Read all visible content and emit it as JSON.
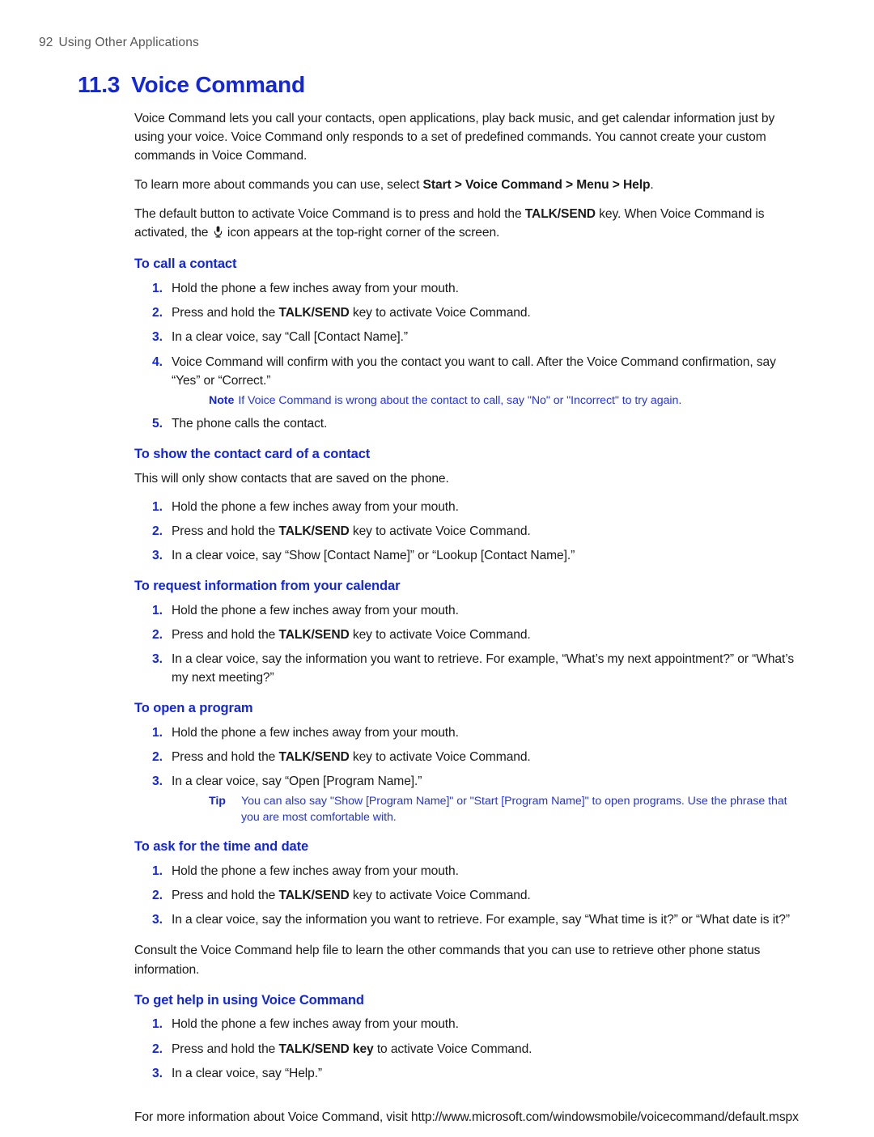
{
  "header": {
    "page_number": "92",
    "chapter_name": "Using Other Applications"
  },
  "title": {
    "number": "11.3",
    "text": "Voice Command"
  },
  "intro": {
    "para1": "Voice Command lets you call your contacts, open applications, play back music, and get calendar information just by using your voice. Voice Command only responds to a set of predefined commands. You cannot create your custom commands in Voice Command.",
    "para2_prefix": "To learn more about commands you can use, select ",
    "para2_bold": "Start > Voice Command > Menu > Help",
    "para2_suffix": ".",
    "para3_a": "The default button to activate Voice Command is to press and hold the ",
    "para3_bold": "TALK/SEND",
    "para3_b": " key. When Voice Command is activated, the ",
    "para3_icon": "microphone-icon",
    "para3_c": " icon appears at the top-right corner of the screen."
  },
  "sections": [
    {
      "heading": "To call a contact",
      "lead": "",
      "steps": [
        {
          "n": "1.",
          "text": "Hold the phone a few inches away from your mouth."
        },
        {
          "n": "2.",
          "pre": "Press and hold the ",
          "bold": "TALK/SEND",
          "post": " key to activate Voice Command."
        },
        {
          "n": "3.",
          "text": "In a clear voice, say “Call [Contact Name].”"
        },
        {
          "n": "4.",
          "text": "Voice Command will confirm with you the contact you want to call. After the Voice Command confirmation, say “Yes” or “Correct.”",
          "callout": {
            "label": "Note",
            "text": "If Voice Command is wrong about the contact to call, say \"No\" or \"Incorrect\" to try again.",
            "hanging": false
          }
        },
        {
          "n": "5.",
          "text": "The phone calls the contact."
        }
      ]
    },
    {
      "heading": "To show the contact card of a contact",
      "lead": "This will only show contacts that are saved on the phone.",
      "steps": [
        {
          "n": "1.",
          "text": "Hold the phone a few inches away from your mouth."
        },
        {
          "n": "2.",
          "pre": "Press and hold the ",
          "bold": "TALK/SEND",
          "post": " key to activate Voice Command."
        },
        {
          "n": "3.",
          "text": "In a clear voice, say “Show [Contact Name]” or “Lookup [Contact Name].”"
        }
      ]
    },
    {
      "heading": "To request information from your calendar",
      "lead": "",
      "steps": [
        {
          "n": "1.",
          "text": "Hold the phone a few inches away from your mouth."
        },
        {
          "n": "2.",
          "pre": "Press and hold the ",
          "bold": "TALK/SEND",
          "post": " key to activate Voice Command."
        },
        {
          "n": "3.",
          "text": "In a clear voice, say the information you want to retrieve. For example, “What’s my next appointment?” or “What’s my next meeting?”"
        }
      ]
    },
    {
      "heading": "To open a program",
      "lead": "",
      "steps": [
        {
          "n": "1.",
          "text": "Hold the phone a few inches away from your mouth."
        },
        {
          "n": "2.",
          "pre": "Press and hold the ",
          "bold": "TALK/SEND",
          "post": " key to activate Voice Command."
        },
        {
          "n": "3.",
          "text": "In a clear voice, say “Open [Program Name].”",
          "callout": {
            "label": "Tip",
            "text": "You can also say \"Show [Program Name]\" or \"Start [Program Name]\" to open programs. Use the phrase that you are most comfortable with.",
            "hanging": true
          }
        }
      ]
    },
    {
      "heading": "To ask for the time and date",
      "lead": "",
      "steps": [
        {
          "n": "1.",
          "text": "Hold the phone a few inches away from your mouth."
        },
        {
          "n": "2.",
          "pre": "Press and hold the ",
          "bold": "TALK/SEND",
          "post": " key to activate Voice Command."
        },
        {
          "n": "3.",
          "text": "In a clear voice, say the information you want to retrieve. For example, say “What time is it?” or “What date is it?”"
        }
      ]
    },
    {
      "heading": "To get help in using Voice Command",
      "lead": "",
      "steps": [
        {
          "n": "1.",
          "text": "Hold the phone a few inches away from your mouth."
        },
        {
          "n": "2.",
          "pre": "Press and hold the ",
          "bold": "TALK/SEND key",
          "post": " to activate Voice Command."
        },
        {
          "n": "3.",
          "text": "In a clear voice, say “Help.”"
        }
      ]
    }
  ],
  "closing": {
    "consult_para": "Consult the Voice Command help file to learn the other commands that you can use to retrieve other phone status information.",
    "final_para": "For more information about Voice Command, visit http://www.microsoft.com/windowsmobile/voicecommand/default.mspx"
  },
  "colors": {
    "heading_blue": "#1226e0",
    "callout_blue": "#2233ee",
    "header_gray": "#58585a",
    "body_black": "#1a1a1a"
  }
}
